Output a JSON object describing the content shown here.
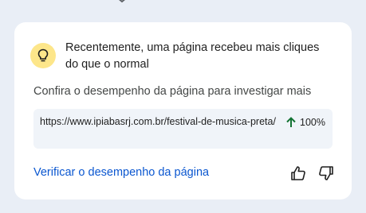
{
  "card": {
    "title": "Recentemente, uma página recebeu mais cliques do que o normal",
    "subtitle": "Confira o desempenho da página para investigar mais",
    "url": "https://www.ipiabasrj.com.br/festival-de-musica-preta/",
    "metric": "100%",
    "metric_trend": "up",
    "metric_color": "#137333",
    "action_label": "Verificar o desempenho da página",
    "icons": {
      "lightbulb": "lightbulb-icon",
      "arrow": "arrow-up-icon",
      "like": "thumb-up-icon",
      "dislike": "thumb-down-icon"
    }
  }
}
